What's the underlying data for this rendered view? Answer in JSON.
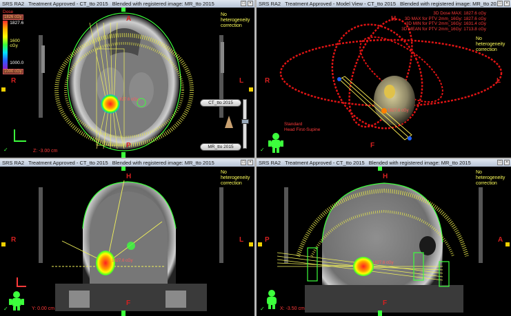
{
  "views": [
    {
      "id": "axial",
      "title": [
        "SRS RA2",
        "Treatment Approved - CT_tto 2015",
        "Blended with registered image: MR_tto 2015"
      ],
      "orient": {
        "top": "A",
        "bottom": "P",
        "left": "R",
        "right": "L"
      },
      "heterogeneity": "No heterogeneity correction",
      "coord": "Z: -3.00 cm",
      "dose_label": "1827.6 cGy"
    },
    {
      "id": "model",
      "title": [
        "SRS RA2",
        "Treatment Approved - Model View - CT_tto 2015",
        "Blended with registered image: MR_tto 2015"
      ],
      "orient": {
        "top": "H",
        "bottom": "F",
        "left": "R",
        "right": "L"
      },
      "heterogeneity": "No heterogeneity correction",
      "stats": [
        "3D Dose MAX: 1827.6 cGy",
        "3D MAX for PTV 2mm_16Gy: 1827.6 cGy",
        "3D MIN for PTV 2mm_16Gy: 1631.4 cGy",
        "3D MEAN for PTV 2mm_16Gy: 1713.8 cGy"
      ],
      "patient_orientation": [
        "Standard",
        "Head First-Supine"
      ],
      "dose_label": "1827.6 cGy"
    },
    {
      "id": "coronal",
      "title": [
        "SRS RA2",
        "Treatment Approved - CT_tto 2015",
        "Blended with registered image: MR_tto 2015"
      ],
      "orient": {
        "top": "H",
        "bottom": "F",
        "left": "R",
        "right": "L"
      },
      "heterogeneity": "No heterogeneity correction",
      "coord": "Y: 0.00 cm",
      "dose_label": "1827.6 cGy"
    },
    {
      "id": "sagittal",
      "title": [
        "SRS RA2",
        "Treatment Approved - CT_tto 2015",
        "Blended with registered image: MR_tto 2015"
      ],
      "orient": {
        "top": "H",
        "bottom": "F",
        "left": "P",
        "right": "A"
      },
      "heterogeneity": "No heterogeneity correction",
      "coord": "X: -3.50 cm",
      "dose_label": "1827.6 cGy"
    }
  ],
  "dose_legend": {
    "title": "Dose",
    "top_value": "1827.6",
    "top_box": "1826 cGy",
    "mid": "1600 cGy",
    "low": "1000.0",
    "bottom_box": "1000 cGy",
    "colors": [
      "#ff2a2a",
      "#ffae00",
      "#ffff00",
      "#39ff3a",
      "#00e4ff",
      "#2c5bff",
      "#8a1fc8"
    ]
  },
  "blend_control": {
    "top_label": "CT_tto 2015",
    "bottom_label": "MR_tto 2015"
  }
}
